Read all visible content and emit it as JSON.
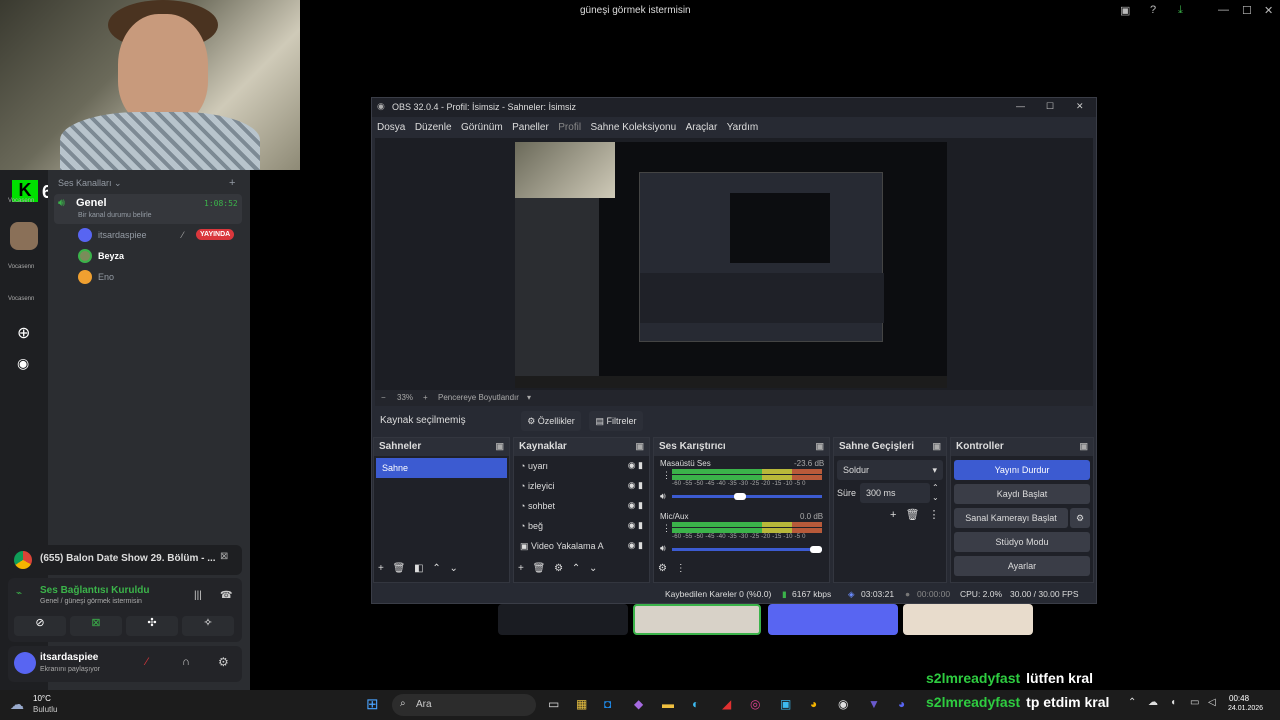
{
  "screen": {
    "top_title": "güneşi görmek istermisin",
    "chat": [
      {
        "user": "s2lmreadyfast",
        "message": "lütfen kral"
      },
      {
        "user": "s2lmreadyfast",
        "message": "tp etdim kral"
      }
    ]
  },
  "discord": {
    "server_badge": "6",
    "server_labels": [
      "Vocasenn",
      "Vocasenn",
      "Vocasenn"
    ],
    "section_title": "Ses Kanalları",
    "channel": {
      "name": "Genel",
      "timer": "1:08:52",
      "status": "Bir kanal durumu belirle"
    },
    "members": [
      {
        "name": "itsardaspiee",
        "badge": "YAYINDA"
      },
      {
        "name": "Beyza"
      },
      {
        "name": "Eno"
      }
    ],
    "activity": "(655) Balon Date Show 29. Bölüm - ...",
    "voice_status": "Ses Bağlantısı Kuruldu",
    "voice_sub": "Genel / güneşi görmek istermisin",
    "user": {
      "name": "itsardaspiee",
      "status": "Ekranını paylaşıyor"
    }
  },
  "obs": {
    "title": "OBS 32.0.4 - Profil: İsimsiz - Sahneler: İsimsiz",
    "menu": [
      "Dosya",
      "Düzenle",
      "Görünüm",
      "Paneller",
      "Profil",
      "Sahne Koleksiyonu",
      "Araçlar",
      "Yardım"
    ],
    "zoom": "33%",
    "fit_label": "Pencereye Boyutlandır",
    "no_source": "Kaynak seçilmemiş",
    "properties": "Özellikler",
    "filters": "Filtreler",
    "scenes": {
      "title": "Sahneler",
      "items": [
        "Sahne"
      ]
    },
    "sources": {
      "title": "Kaynaklar",
      "items": [
        "uyarı",
        "izleyici",
        "sohbet",
        "beğ",
        "Video Yakalama A"
      ]
    },
    "mixer": {
      "title": "Ses Karıştırıcı",
      "channels": [
        {
          "name": "Masaüstü Ses",
          "db": "-23.6 dB"
        },
        {
          "name": "Mic/Aux",
          "db": "0.0 dB"
        }
      ],
      "ticks": "-60 -55 -50 -45 -40 -35 -30 -25 -20 -15 -10 -5 0"
    },
    "transitions": {
      "title": "Sahne Geçişleri",
      "selected": "Soldur",
      "duration_label": "Süre",
      "duration": "300 ms"
    },
    "controls": {
      "title": "Kontroller",
      "buttons": [
        "Yayını Durdur",
        "Kaydı Başlat",
        "Sanal Kamerayı Başlat",
        "Stüdyo Modu",
        "Ayarlar"
      ]
    },
    "status": {
      "dropped": "Kaybedilen Kareler 0 (%0.0)",
      "bitrate": "6167 kbps",
      "stream_time": "03:03:21",
      "rec_time": "00:00:00",
      "cpu": "CPU: 2.0%",
      "fps": "30.00 / 30.00 FPS"
    }
  },
  "taskbar": {
    "weather_temp": "10°C",
    "weather_text": "Bulutlu",
    "search": "Ara",
    "time": "00:48",
    "date": "24.01.2026"
  }
}
